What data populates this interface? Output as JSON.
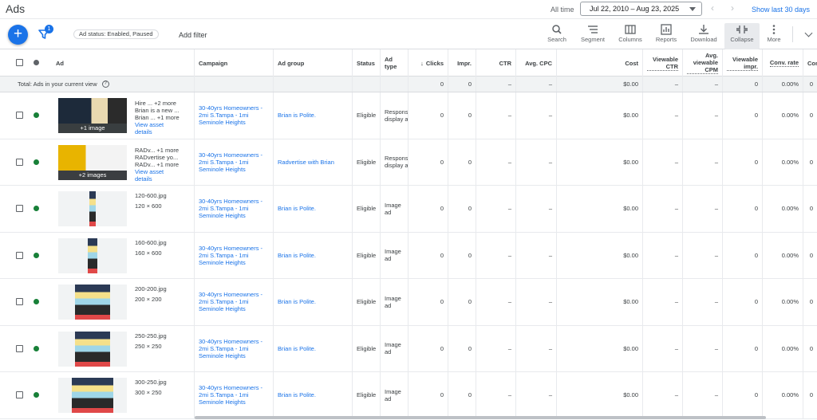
{
  "header": {
    "title": "Ads",
    "all_time": "All time",
    "date_range": "Jul 22, 2010 – Aug 23, 2025",
    "show_last": "Show last 30 days"
  },
  "toolbar": {
    "add_icon": "+",
    "filter_badge": "1",
    "status_chip": "Ad status: Enabled, Paused",
    "add_filter": "Add filter",
    "tools": [
      {
        "label": "Search",
        "icon": "search-icon"
      },
      {
        "label": "Segment",
        "icon": "segment-icon"
      },
      {
        "label": "Columns",
        "icon": "columns-icon"
      },
      {
        "label": "Reports",
        "icon": "reports-icon"
      },
      {
        "label": "Download",
        "icon": "download-icon"
      },
      {
        "label": "Collapse",
        "icon": "collapse-icon"
      },
      {
        "label": "More",
        "icon": "more-icon"
      }
    ]
  },
  "columns": {
    "ad": "Ad",
    "campaign": "Campaign",
    "ad_group": "Ad group",
    "status": "Status",
    "ad_type": "Ad type",
    "clicks": "Clicks",
    "impr": "Impr.",
    "ctr": "CTR",
    "avg_cpc": "Avg. CPC",
    "cost": "Cost",
    "viewable_ctr": "Viewable CTR",
    "avg_viewable_cpm": "Avg. viewable CPM",
    "viewable_impr": "Viewable impr.",
    "conv_rate": "Conv. rate",
    "conv": "Con"
  },
  "totals": {
    "label": "Total: Ads in your current view",
    "clicks": "0",
    "impr": "0",
    "ctr": "–",
    "avg_cpc": "–",
    "cost": "$0.00",
    "viewable_ctr": "–",
    "avg_viewable_cpm": "–",
    "viewable_impr": "0",
    "conv_rate": "0.00%",
    "conv": "0"
  },
  "rows": [
    {
      "kind": "responsive",
      "caption": "+1 image",
      "line1": "Hire ...  +2 more",
      "line2": "Brian is a new ...",
      "line3": "Brian ...  +1 more",
      "link": "View asset details",
      "campaign": "30-40yrs Homeowners - 2mi S.Tampa - 1mi Seminole Heights",
      "ad_group": "Brian is Polite.",
      "status": "Eligible",
      "ad_type": "Responsive display ad",
      "clicks": "0",
      "impr": "0",
      "ctr": "–",
      "avg_cpc": "–",
      "cost": "$0.00",
      "viewable_ctr": "–",
      "avg_viewable_cpm": "–",
      "viewable_impr": "0",
      "conv_rate": "0.00%",
      "conv": "0"
    },
    {
      "kind": "responsive",
      "caption": "+2 images",
      "line1": "RADv...  +1 more",
      "line2": "RADvertise yo...",
      "line3": "RADv...  +1 more",
      "link": "View asset details",
      "campaign": "30-40yrs Homeowners - 2mi S.Tampa - 1mi Seminole Heights",
      "ad_group": "Radvertise with Brian",
      "status": "Eligible",
      "ad_type": "Responsive display ad",
      "clicks": "0",
      "impr": "0",
      "ctr": "–",
      "avg_cpc": "–",
      "cost": "$0.00",
      "viewable_ctr": "–",
      "avg_viewable_cpm": "–",
      "viewable_impr": "0",
      "conv_rate": "0.00%",
      "conv": "0"
    },
    {
      "kind": "image",
      "file": "120-600.jpg",
      "size": "120 × 600",
      "campaign": "30-40yrs Homeowners - 2mi S.Tampa - 1mi Seminole Heights",
      "ad_group": "Brian is Polite.",
      "status": "Eligible",
      "ad_type": "Image ad",
      "clicks": "0",
      "impr": "0",
      "ctr": "–",
      "avg_cpc": "–",
      "cost": "$0.00",
      "viewable_ctr": "–",
      "avg_viewable_cpm": "–",
      "viewable_impr": "0",
      "conv_rate": "0.00%",
      "conv": "0"
    },
    {
      "kind": "image",
      "file": "160-600.jpg",
      "size": "160 × 600",
      "campaign": "30-40yrs Homeowners - 2mi S.Tampa - 1mi Seminole Heights",
      "ad_group": "Brian is Polite.",
      "status": "Eligible",
      "ad_type": "Image ad",
      "clicks": "0",
      "impr": "0",
      "ctr": "–",
      "avg_cpc": "–",
      "cost": "$0.00",
      "viewable_ctr": "–",
      "avg_viewable_cpm": "–",
      "viewable_impr": "0",
      "conv_rate": "0.00%",
      "conv": "0"
    },
    {
      "kind": "image",
      "file": "200-200.jpg",
      "size": "200 × 200",
      "campaign": "30-40yrs Homeowners - 2mi S.Tampa - 1mi Seminole Heights",
      "ad_group": "Brian is Polite.",
      "status": "Eligible",
      "ad_type": "Image ad",
      "clicks": "0",
      "impr": "0",
      "ctr": "–",
      "avg_cpc": "–",
      "cost": "$0.00",
      "viewable_ctr": "–",
      "avg_viewable_cpm": "–",
      "viewable_impr": "0",
      "conv_rate": "0.00%",
      "conv": "0"
    },
    {
      "kind": "image",
      "file": "250-250.jpg",
      "size": "250 × 250",
      "campaign": "30-40yrs Homeowners - 2mi S.Tampa - 1mi Seminole Heights",
      "ad_group": "Brian is Polite.",
      "status": "Eligible",
      "ad_type": "Image ad",
      "clicks": "0",
      "impr": "0",
      "ctr": "–",
      "avg_cpc": "–",
      "cost": "$0.00",
      "viewable_ctr": "–",
      "avg_viewable_cpm": "–",
      "viewable_impr": "0",
      "conv_rate": "0.00%",
      "conv": "0"
    },
    {
      "kind": "image",
      "file": "300-250.jpg",
      "size": "300 × 250",
      "campaign": "30-40yrs Homeowners - 2mi S.Tampa - 1mi Seminole Heights",
      "ad_group": "Brian is Polite.",
      "status": "Eligible",
      "ad_type": "Image ad",
      "clicks": "0",
      "impr": "0",
      "ctr": "–",
      "avg_cpc": "–",
      "cost": "$0.00",
      "viewable_ctr": "–",
      "avg_viewable_cpm": "–",
      "viewable_impr": "0",
      "conv_rate": "0.00%",
      "conv": "0"
    }
  ],
  "colors": {
    "accent": "#1a73e8",
    "enabled_dot": "#188038",
    "header_dot": "#5f6368"
  }
}
